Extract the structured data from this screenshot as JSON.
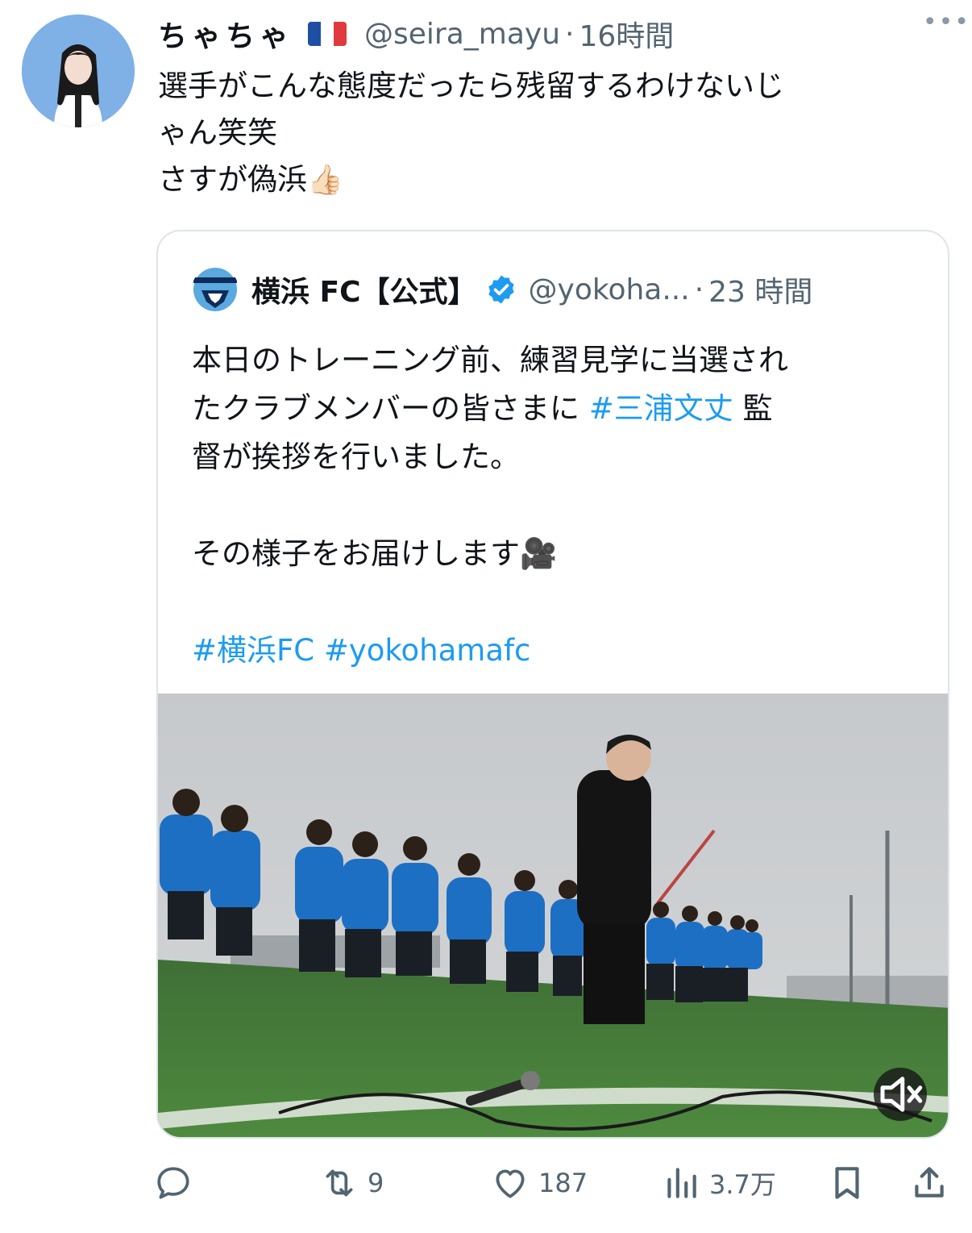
{
  "tweet": {
    "author_name": "ちゃちゃ",
    "flag_icon": "france-flag-icon",
    "handle": "@seira_mayu",
    "separator": "·",
    "time": "16時間",
    "more_icon": "more-options-icon",
    "text": "選手がこんな態度だったら残留するわけないじ\nゃん笑笑\nさすが偽浜",
    "emoji": "👍🏻"
  },
  "quoted": {
    "name": "横浜 FC【公式】",
    "verified_icon": "verified-badge-icon",
    "handle": "@yokoha...",
    "separator": "·",
    "time": "23 時間",
    "text_part1": "本日のトレーニング前、練習見学に当選され\nたクラブメンバーの皆さまに ",
    "hashtag_coach": "#三浦文丈",
    "text_part2": " 監\n督が挨拶を行いました。\n\nその様子をお届けします",
    "camera_emoji": "🎥",
    "hashtag_fc": "#横浜FC",
    "hashtag_en": "#yokohamafc",
    "media_icon": "mute-icon"
  },
  "actions": {
    "reply_icon": "reply-icon",
    "retweet_icon": "retweet-icon",
    "retweet_count": "9",
    "like_icon": "like-icon",
    "like_count": "187",
    "views_icon": "views-icon",
    "views_count": "3.7万",
    "bookmark_icon": "bookmark-icon",
    "share_icon": "share-icon"
  },
  "colors": {
    "accent": "#1d9bf0",
    "muted": "#536471",
    "border": "#dfe4e8"
  }
}
